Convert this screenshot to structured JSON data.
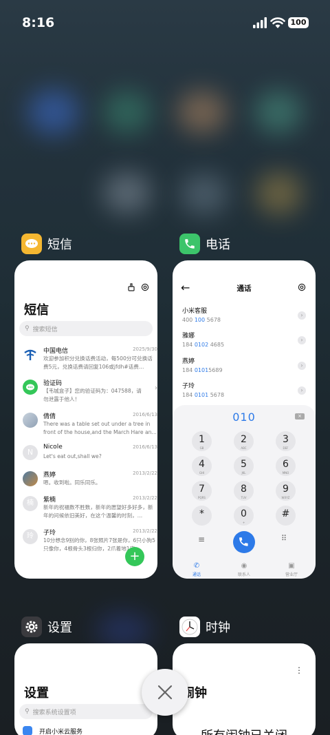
{
  "status_bar": {
    "time": "8:16",
    "battery": "100"
  },
  "apps": {
    "sms": {
      "name": "短信",
      "title": "短信",
      "search_placeholder": "搜索短信",
      "messages": [
        {
          "name": "中国电信",
          "date": "2025/9/30",
          "body": "欢迎参加积分兑换话费活动，每500分可兑换话费5元，兑换话费请回复106或jfdh#话费…"
        },
        {
          "name": "验证码",
          "date": "",
          "body": "【韦城盒子】您的验证码为：047588，请勿泄露于他人！"
        },
        {
          "name": "倩倩",
          "date": "2016/6/13",
          "body": "There was a table set out under a tree in front of the house,and the March Hare an…"
        },
        {
          "name": "Nicole",
          "date": "2016/6/13",
          "body": "Let's eat out,shall we?"
        },
        {
          "name": "燕婷",
          "date": "2013/2/22",
          "body": "嗯。收到啦。同乐同乐。"
        },
        {
          "name": "紫楠",
          "date": "2013/2/22",
          "body": "新年的祝福数不胜数，新年的愿望好多好多，新年的问候依旧美好，在这个温馨的时刻，…"
        },
        {
          "name": "子玲",
          "date": "2013/2/22",
          "body": "10分想念9别的你，8张照片7张是你，6只小狗5只像你，4根骨头3根归你，2爪着地1定…"
        }
      ],
      "avatar_letters": {
        "nicole": "N",
        "zinan": "楠",
        "ziling": "玲"
      },
      "fab": "+"
    },
    "phone": {
      "name": "电话",
      "title": "通话",
      "contacts": [
        {
          "name": "小米客服",
          "pre": "400 ",
          "hl": "100",
          "post": " 5678"
        },
        {
          "name": "雅娜",
          "pre": "184 ",
          "hl": "0102",
          "post": " 4685"
        },
        {
          "name": "燕婷",
          "pre": "184 ",
          "hl": "0101",
          "post": "5689"
        },
        {
          "name": "子玲",
          "pre": "184 ",
          "hl": "0101",
          "post": " 5678"
        }
      ],
      "dialed": "010",
      "keys": [
        {
          "d": "1",
          "l": "GB"
        },
        {
          "d": "2",
          "l": "ABC"
        },
        {
          "d": "3",
          "l": "DEF"
        },
        {
          "d": "4",
          "l": "GHI"
        },
        {
          "d": "5",
          "l": "JKL"
        },
        {
          "d": "6",
          "l": "MNO"
        },
        {
          "d": "7",
          "l": "PQRS"
        },
        {
          "d": "8",
          "l": "TUV"
        },
        {
          "d": "9",
          "l": "WXYZ"
        },
        {
          "d": "*",
          "l": ""
        },
        {
          "d": "0",
          "l": "+"
        },
        {
          "d": "#",
          "l": ""
        }
      ],
      "tabs": [
        "通话",
        "联系人",
        "营业厅"
      ],
      "accent": "#2d7ae8"
    },
    "settings": {
      "name": "设置",
      "title": "设置",
      "search_placeholder": "搜索系统设置项",
      "first_item": "开启小米云服务"
    },
    "clock": {
      "name": "时钟",
      "title": "闹钟",
      "message": "所有闹钟已关闭"
    }
  }
}
